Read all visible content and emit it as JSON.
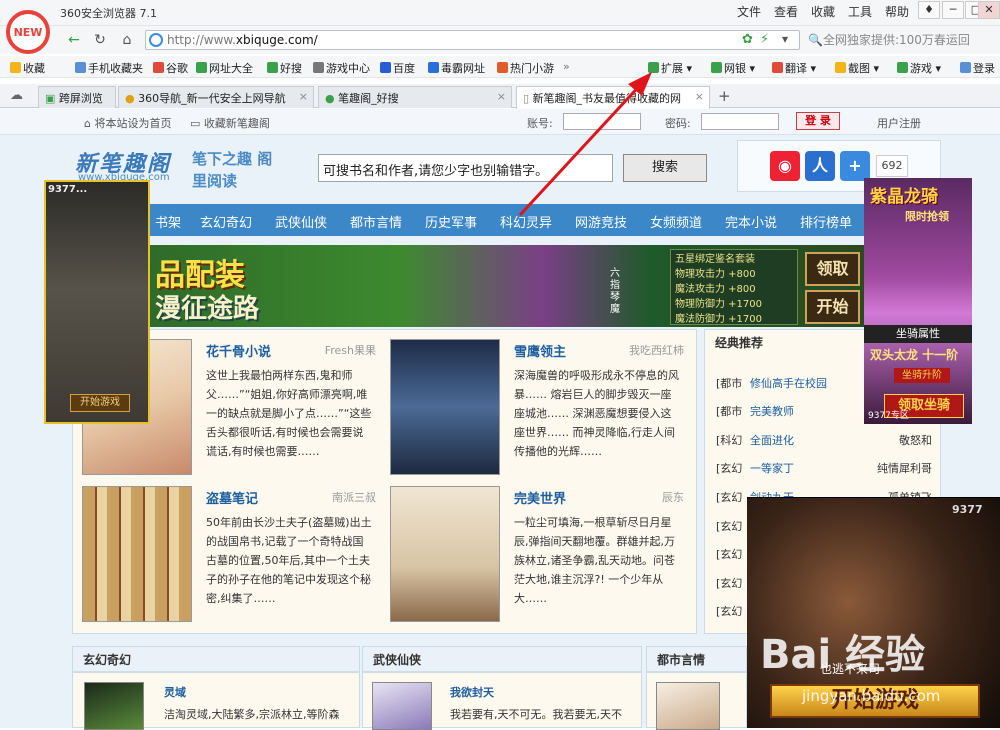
{
  "browser": {
    "logo_text": "NEW",
    "app_title": "360安全浏览器 7.1",
    "menu": [
      "文件",
      "查看",
      "收藏",
      "工具",
      "帮助"
    ],
    "window_buttons": [
      "♦",
      "─",
      "□",
      "✕"
    ],
    "url_prefix": "http://www.",
    "url_domain": "xbiquge.com/",
    "search_hint": "全网独家提供:100万春运回",
    "bookmarks": [
      "收藏",
      "手机收藏夹",
      "谷歌",
      "网址大全",
      "好搜",
      "游戏中心",
      "百度",
      "毒霸网址",
      "热门小游",
      "扩展",
      "网银",
      "翻译",
      "截图",
      "游戏",
      "登录"
    ],
    "tabs": [
      {
        "label": "跨屏浏览"
      },
      {
        "label": "360导航_新一代安全上网导航"
      },
      {
        "label": "笔趣阁_好搜"
      },
      {
        "label": "新笔趣阁_书友最值得收藏的网"
      }
    ],
    "new_tab": "+",
    "tab_close": "×",
    "accent": "#e8433a"
  },
  "site": {
    "set_home": "将本站设为首页",
    "add_fav": "收藏新笔趣阁",
    "account_label": "账号:",
    "password_label": "密码:",
    "login_button": "登 录",
    "register": "用户注册",
    "logo": "新笔趣阁",
    "logo_domain": "www.xbiquge.com",
    "slogan": "笔下之趣 阁里阅读",
    "search_placeholder": "可搜书名和作者,请您少字也别输错字。",
    "search_button": "搜索",
    "share_count": "692",
    "nav": [
      "书架",
      "玄幻奇幻",
      "武侠仙侠",
      "都市言情",
      "历史军事",
      "科幻灵异",
      "网游竞技",
      "女频频道",
      "完本小说",
      "排行榜单"
    ],
    "nav_color": "#3c87c8"
  },
  "banner": {
    "text1": "品配装",
    "text2": "漫征途路",
    "label": "六指琴魔",
    "stats": [
      "五星绑定鉴名套装",
      "物理攻击力 +800",
      "魔法攻击力 +800",
      "物理防御力 +1700",
      "魔法防御力 +1700"
    ],
    "btn1": "领取",
    "btn2": "开始"
  },
  "books": [
    {
      "title": "花千骨小说",
      "author": "Fresh果果",
      "desc": "这世上我最怕两样东西,鬼和师父……”“姐姐,你好高师漂亮啊,唯一的缺点就是脚小了点……”“这些舌头都很听话,有时候也会需要说谎话,有时候也需要……"
    },
    {
      "title": "雪鹰领主",
      "author": "我吃西红柿",
      "desc": "深海魔兽的呼吸形成永不停息的风暴…… 熔岩巨人的脚步毁灭一座座城池…… 深渊恶魔想要侵入这座世界…… 而神灵降临,行走人间传播他的光辉……"
    },
    {
      "title": "盗墓笔记",
      "author": "南派三叔",
      "desc": "50年前由长沙土夫子(盗墓贼)出土的战国帛书,记载了一个奇特战国古墓的位置,50年后,其中一个土夫子的孙子在他的笔记中发现这个秘密,纠集了……"
    },
    {
      "title": "完美世界",
      "author": "辰东",
      "desc": "一粒尘可填海,一根草斩尽日月星辰,弹指间天翻地覆。群雄并起,万族林立,诸圣争霸,乱天动地。问苍茫大地,谁主沉浮?! 一个少年从大……"
    }
  ],
  "classics": {
    "heading": "经典推荐",
    "items": [
      {
        "cat": "[都市",
        "title": "修仙高手在校园",
        "author": ""
      },
      {
        "cat": "[都市",
        "title": "完美教师",
        "author": ""
      },
      {
        "cat": "[科幻",
        "title": "全面进化",
        "author": "敬怒和"
      },
      {
        "cat": "[玄幻",
        "title": "一等家丁",
        "author": "纯情犀利哥"
      },
      {
        "cat": "[玄幻",
        "title": "剑动九天",
        "author": "孤单镇飞"
      },
      {
        "cat": "[玄幻",
        "title": "",
        "author": ""
      },
      {
        "cat": "[玄幻",
        "title": "",
        "author": ""
      },
      {
        "cat": "[玄幻",
        "title": "",
        "author": ""
      },
      {
        "cat": "[玄幻",
        "title": "",
        "author": ""
      }
    ]
  },
  "sections": [
    {
      "head": "玄幻奇幻",
      "title": "灵域",
      "desc": "洁淘灵域,大陆繁多,宗派林立,等阶森"
    },
    {
      "head": "武侠仙侠",
      "title": "我欲封天",
      "desc": "我若要有,天不可无。我若要无,天不"
    },
    {
      "head": "都市言情",
      "title": "",
      "desc": ""
    }
  ],
  "ads": {
    "left_brand": "9377...",
    "left_btn": "开始游戏",
    "right_title": "紫晶龙骑",
    "right_sub": "限时抢领",
    "right_band": "坐骑属性",
    "right_title2": "双头太龙 十一阶",
    "right_btn1": "坐骑升阶",
    "right_btn2": "领取坐骑",
    "right_brand": "9377专区",
    "video_brand": "9377",
    "video_caption": "也逃不来司",
    "video_btn": "开始游戏"
  },
  "watermark": {
    "text": "Bai 经验",
    "sub": "jingyan.baidu.com"
  }
}
